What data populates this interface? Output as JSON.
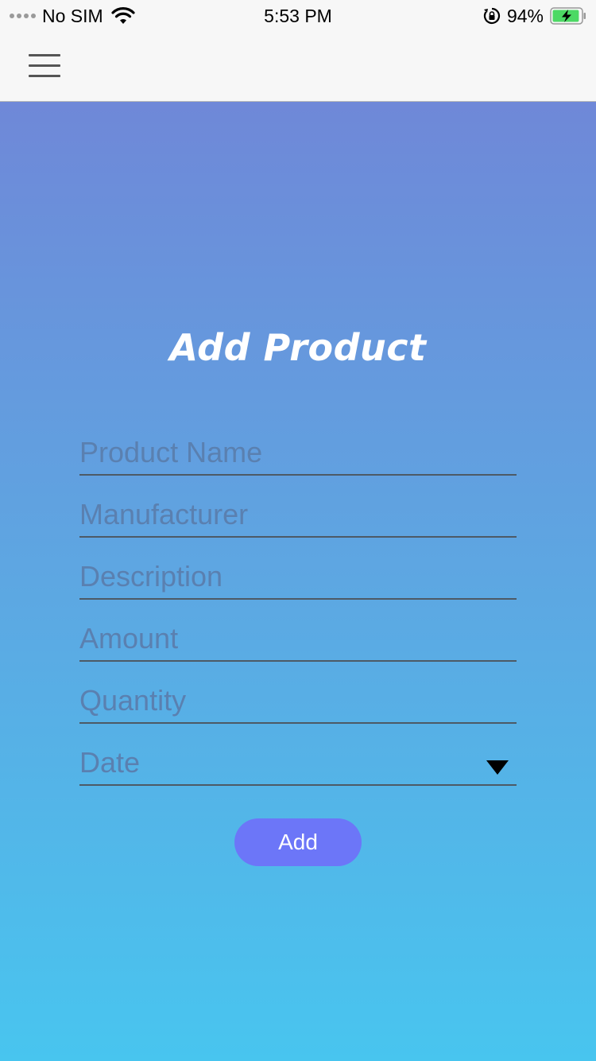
{
  "status_bar": {
    "carrier": "No SIM",
    "time": "5:53 PM",
    "battery_percent": "94%",
    "battery_level": 0.94,
    "icons": [
      "signal-dots-icon",
      "wifi-icon",
      "orientation-lock-icon",
      "battery-charging-icon"
    ]
  },
  "nav": {
    "menu_icon": "hamburger-menu-icon"
  },
  "form": {
    "title": "Add Product",
    "fields": [
      {
        "placeholder": "Product Name",
        "value": ""
      },
      {
        "placeholder": "Manufacturer",
        "value": ""
      },
      {
        "placeholder": "Description",
        "value": ""
      },
      {
        "placeholder": "Amount",
        "value": ""
      },
      {
        "placeholder": "Quantity",
        "value": ""
      },
      {
        "placeholder": "Date",
        "value": ""
      }
    ],
    "submit_label": "Add"
  },
  "colors": {
    "gradient_top": "#6f88d8",
    "gradient_bottom": "#48c5ef",
    "button": "#6c76f8",
    "battery_fill": "#4cd964"
  }
}
